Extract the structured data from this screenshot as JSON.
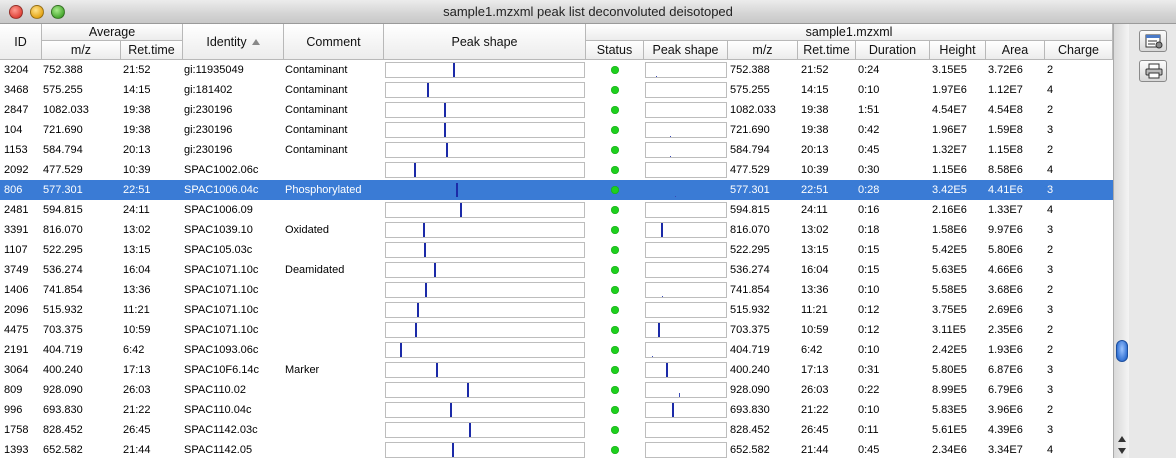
{
  "window": {
    "title": "sample1.mzxml peak list deconvoluted deisotoped"
  },
  "headers": {
    "id": "ID",
    "average_group": "Average",
    "avg_mz": "m/z",
    "avg_rt": "Ret.time",
    "identity": "Identity",
    "comment": "Comment",
    "peak_shape": "Peak shape",
    "sample_group": "sample1.mzxml",
    "status": "Status",
    "sample_peak_shape": "Peak shape",
    "mz": "m/z",
    "rt": "Ret.time",
    "duration": "Duration",
    "height": "Height",
    "area": "Area",
    "charge": "Charge"
  },
  "colors": {
    "selection": "#3a7bd5",
    "status_ok": "#1ed01e",
    "peak": "#1b2aa8"
  },
  "icons": {
    "properties": "properties-icon",
    "print": "print-icon"
  },
  "rows": [
    {
      "id": "3204",
      "avg_mz": "752.388",
      "avg_rt": "21:52",
      "identity": "gi:11935049",
      "comment": "Contaminant",
      "mz": "752.388",
      "rt": "21:52",
      "duration": "0:24",
      "height": "3.15E5",
      "area": "3.72E6",
      "charge": "2",
      "peak_pos": 0.34,
      "peak_h": 1.0,
      "s_pos": 0.12,
      "s_h": 0.05,
      "selected": false
    },
    {
      "id": "3468",
      "avg_mz": "575.255",
      "avg_rt": "14:15",
      "identity": "gi:181402",
      "comment": "Contaminant",
      "mz": "575.255",
      "rt": "14:15",
      "duration": "0:10",
      "height": "1.97E6",
      "area": "1.12E7",
      "charge": "4",
      "peak_pos": 0.205,
      "peak_h": 1.0,
      "s_pos": 0.12,
      "s_h": 0.0,
      "selected": false
    },
    {
      "id": "2847",
      "avg_mz": "1082.033",
      "avg_rt": "19:38",
      "identity": "gi:230196",
      "comment": "Contaminant",
      "mz": "1082.033",
      "rt": "19:38",
      "duration": "1:51",
      "height": "4.54E7",
      "area": "4.54E8",
      "charge": "2",
      "peak_pos": 0.295,
      "peak_h": 1.0,
      "s_pos": 0.12,
      "s_h": 0.0,
      "selected": false
    },
    {
      "id": "104",
      "avg_mz": "721.690",
      "avg_rt": "19:38",
      "identity": "gi:230196",
      "comment": "Contaminant",
      "mz": "721.690",
      "rt": "19:38",
      "duration": "0:42",
      "height": "1.96E7",
      "area": "1.59E8",
      "charge": "3",
      "peak_pos": 0.295,
      "peak_h": 1.0,
      "s_pos": 0.3,
      "s_h": 0.1,
      "selected": false
    },
    {
      "id": "1153",
      "avg_mz": "584.794",
      "avg_rt": "20:13",
      "identity": "gi:230196",
      "comment": "Contaminant",
      "mz": "584.794",
      "rt": "20:13",
      "duration": "0:45",
      "height": "1.32E7",
      "area": "1.15E8",
      "charge": "2",
      "peak_pos": 0.305,
      "peak_h": 1.0,
      "s_pos": 0.3,
      "s_h": 0.05,
      "selected": false
    },
    {
      "id": "2092",
      "avg_mz": "477.529",
      "avg_rt": "10:39",
      "identity": "SPAC1002.06c",
      "comment": "",
      "mz": "477.529",
      "rt": "10:39",
      "duration": "0:30",
      "height": "1.15E6",
      "area": "8.58E6",
      "charge": "4",
      "peak_pos": 0.14,
      "peak_h": 1.0,
      "s_pos": 0.14,
      "s_h": 0.0,
      "selected": false
    },
    {
      "id": "806",
      "avg_mz": "577.301",
      "avg_rt": "22:51",
      "identity": "SPAC1006.04c",
      "comment": "Phosphorylated",
      "mz": "577.301",
      "rt": "22:51",
      "duration": "0:28",
      "height": "3.42E5",
      "area": "4.41E6",
      "charge": "3",
      "peak_pos": 0.355,
      "peak_h": 1.0,
      "s_pos": 0.36,
      "s_h": 0.1,
      "selected": true
    },
    {
      "id": "2481",
      "avg_mz": "594.815",
      "avg_rt": "24:11",
      "identity": "SPAC1006.09",
      "comment": "",
      "mz": "594.815",
      "rt": "24:11",
      "duration": "0:16",
      "height": "2.16E6",
      "area": "1.33E7",
      "charge": "4",
      "peak_pos": 0.375,
      "peak_h": 1.0,
      "s_pos": 0.37,
      "s_h": 0.0,
      "selected": false
    },
    {
      "id": "3391",
      "avg_mz": "816.070",
      "avg_rt": "13:02",
      "identity": "SPAC1039.10",
      "comment": "Oxidated",
      "mz": "816.070",
      "rt": "13:02",
      "duration": "0:18",
      "height": "1.58E6",
      "area": "9.97E6",
      "charge": "3",
      "peak_pos": 0.185,
      "peak_h": 1.0,
      "s_pos": 0.185,
      "s_h": 1.0,
      "selected": false
    },
    {
      "id": "1107",
      "avg_mz": "522.295",
      "avg_rt": "13:15",
      "identity": "SPAC105.03c",
      "comment": "",
      "mz": "522.295",
      "rt": "13:15",
      "duration": "0:15",
      "height": "5.42E5",
      "area": "5.80E6",
      "charge": "2",
      "peak_pos": 0.19,
      "peak_h": 1.0,
      "s_pos": 0.19,
      "s_h": 0.0,
      "selected": false
    },
    {
      "id": "3749",
      "avg_mz": "536.274",
      "avg_rt": "16:04",
      "identity": "SPAC1071.10c",
      "comment": "Deamidated",
      "mz": "536.274",
      "rt": "16:04",
      "duration": "0:15",
      "height": "5.63E5",
      "area": "4.66E6",
      "charge": "3",
      "peak_pos": 0.24,
      "peak_h": 1.0,
      "s_pos": 0.24,
      "s_h": 0.0,
      "selected": false
    },
    {
      "id": "1406",
      "avg_mz": "741.854",
      "avg_rt": "13:36",
      "identity": "SPAC1071.10c",
      "comment": "",
      "mz": "741.854",
      "rt": "13:36",
      "duration": "0:10",
      "height": "5.58E5",
      "area": "3.68E6",
      "charge": "2",
      "peak_pos": 0.195,
      "peak_h": 1.0,
      "s_pos": 0.195,
      "s_h": 0.1,
      "selected": false
    },
    {
      "id": "2096",
      "avg_mz": "515.932",
      "avg_rt": "11:21",
      "identity": "SPAC1071.10c",
      "comment": "",
      "mz": "515.932",
      "rt": "11:21",
      "duration": "0:12",
      "height": "3.75E5",
      "area": "2.69E6",
      "charge": "3",
      "peak_pos": 0.155,
      "peak_h": 1.0,
      "s_pos": 0.155,
      "s_h": 0.0,
      "selected": false
    },
    {
      "id": "4475",
      "avg_mz": "703.375",
      "avg_rt": "10:59",
      "identity": "SPAC1071.10c",
      "comment": "",
      "mz": "703.375",
      "rt": "10:59",
      "duration": "0:12",
      "height": "3.11E5",
      "area": "2.35E6",
      "charge": "2",
      "peak_pos": 0.148,
      "peak_h": 1.0,
      "s_pos": 0.148,
      "s_h": 1.0,
      "selected": false
    },
    {
      "id": "2191",
      "avg_mz": "404.719",
      "avg_rt": "6:42",
      "identity": "SPAC1093.06c",
      "comment": "",
      "mz": "404.719",
      "rt": "6:42",
      "duration": "0:10",
      "height": "2.42E5",
      "area": "1.93E6",
      "charge": "2",
      "peak_pos": 0.07,
      "peak_h": 1.0,
      "s_pos": 0.07,
      "s_h": 0.1,
      "selected": false
    },
    {
      "id": "3064",
      "avg_mz": "400.240",
      "avg_rt": "17:13",
      "identity": "SPAC10F6.14c",
      "comment": "Marker",
      "mz": "400.240",
      "rt": "17:13",
      "duration": "0:31",
      "height": "5.80E5",
      "area": "6.87E6",
      "charge": "3",
      "peak_pos": 0.255,
      "peak_h": 1.0,
      "s_pos": 0.255,
      "s_h": 1.0,
      "selected": false
    },
    {
      "id": "809",
      "avg_mz": "928.090",
      "avg_rt": "26:03",
      "identity": "SPAC110.02",
      "comment": "",
      "mz": "928.090",
      "rt": "26:03",
      "duration": "0:22",
      "height": "8.99E5",
      "area": "6.79E6",
      "charge": "3",
      "peak_pos": 0.41,
      "peak_h": 1.0,
      "s_pos": 0.41,
      "s_h": 0.3,
      "selected": false
    },
    {
      "id": "996",
      "avg_mz": "693.830",
      "avg_rt": "21:22",
      "identity": "SPAC110.04c",
      "comment": "",
      "mz": "693.830",
      "rt": "21:22",
      "duration": "0:10",
      "height": "5.83E5",
      "area": "3.96E6",
      "charge": "2",
      "peak_pos": 0.325,
      "peak_h": 1.0,
      "s_pos": 0.325,
      "s_h": 1.0,
      "selected": false
    },
    {
      "id": "1758",
      "avg_mz": "828.452",
      "avg_rt": "26:45",
      "identity": "SPAC1142.03c",
      "comment": "",
      "mz": "828.452",
      "rt": "26:45",
      "duration": "0:11",
      "height": "5.61E5",
      "area": "4.39E6",
      "charge": "3",
      "peak_pos": 0.42,
      "peak_h": 1.0,
      "s_pos": 0.42,
      "s_h": 0.0,
      "selected": false
    },
    {
      "id": "1393",
      "avg_mz": "652.582",
      "avg_rt": "21:44",
      "identity": "SPAC1142.05",
      "comment": "",
      "mz": "652.582",
      "rt": "21:44",
      "duration": "0:45",
      "height": "2.34E6",
      "area": "3.34E7",
      "charge": "4",
      "peak_pos": 0.335,
      "peak_h": 1.0,
      "s_pos": 0.335,
      "s_h": 0.0,
      "selected": false
    }
  ]
}
